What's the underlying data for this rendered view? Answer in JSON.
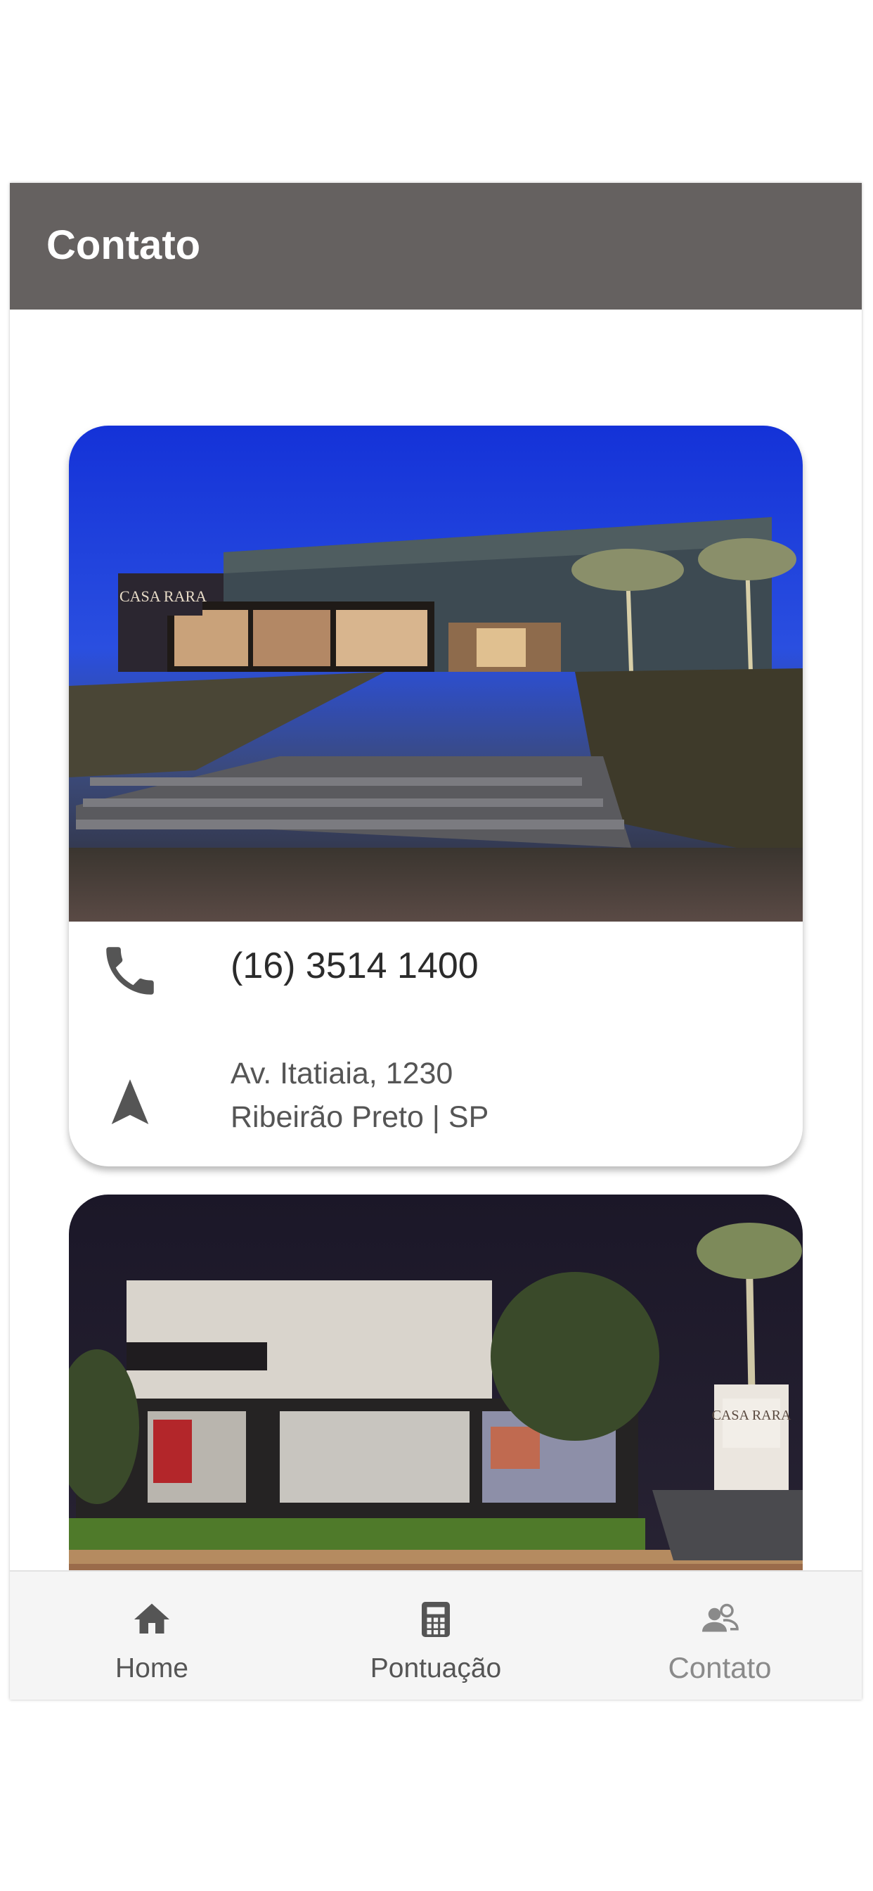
{
  "header": {
    "title": "Contato"
  },
  "locations": [
    {
      "phone": "(16) 3514 1400",
      "address_line1": "Av. Itatiaia, 1230",
      "address_line2": "Ribeirão Preto | SP",
      "phone_icon": "phone-icon",
      "address_icon": "navigation-arrow-icon",
      "sign_text": "CASA RARA"
    },
    {
      "sign_text": "CASA RARA"
    }
  ],
  "nav": {
    "items": [
      {
        "label": "Home",
        "icon": "home-icon"
      },
      {
        "label": "Pontuação",
        "icon": "calculator-icon"
      },
      {
        "label": "Contato",
        "icon": "contacts-icon",
        "active": true
      }
    ]
  },
  "colors": {
    "appbar": "#656160",
    "icon": "#555555",
    "active_nav": "#8a8a8a",
    "nav_bg": "#f5f5f5"
  }
}
